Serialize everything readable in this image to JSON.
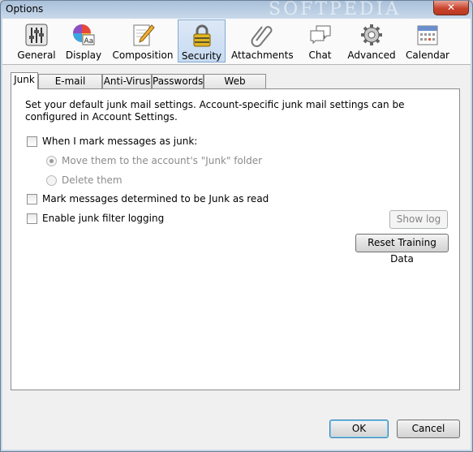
{
  "window": {
    "title": "Options",
    "close_symbol": "✕",
    "watermark": "SOFTPEDIA"
  },
  "toolbar": {
    "items": [
      {
        "label": "General",
        "icon": "sliders-icon",
        "selected": false
      },
      {
        "label": "Display",
        "icon": "palette-icon",
        "selected": false
      },
      {
        "label": "Composition",
        "icon": "pencil-paper-icon",
        "selected": false
      },
      {
        "label": "Security",
        "icon": "padlock-icon",
        "selected": true
      },
      {
        "label": "Attachments",
        "icon": "paperclip-icon",
        "selected": false
      },
      {
        "label": "Chat",
        "icon": "speech-bubbles-icon",
        "selected": false
      },
      {
        "label": "Advanced",
        "icon": "gear-icon",
        "selected": false
      },
      {
        "label": "Calendar",
        "icon": "calendar-icon",
        "selected": false
      }
    ]
  },
  "tabs": [
    {
      "label": "Junk",
      "active": true
    },
    {
      "label": "E-mail Scams",
      "active": false
    },
    {
      "label": "Anti-Virus",
      "active": false
    },
    {
      "label": "Passwords",
      "active": false
    },
    {
      "label": "Web Content",
      "active": false
    }
  ],
  "junk": {
    "description": "Set your default junk mail settings. Account-specific junk mail settings can be configured in Account Settings.",
    "mark_as_junk": {
      "label": "When I mark messages as junk:",
      "checked": false
    },
    "move_option": {
      "label": "Move them to the account's \"Junk\" folder",
      "selected": true,
      "disabled": true
    },
    "delete_option": {
      "label": "Delete them",
      "selected": false,
      "disabled": true
    },
    "mark_read": {
      "label": "Mark messages determined to be Junk as read",
      "checked": false
    },
    "logging": {
      "label": "Enable junk filter logging",
      "checked": false
    },
    "show_log_button": "Show log",
    "reset_button": "Reset Training Data"
  },
  "footer": {
    "ok_button": "OK",
    "cancel_button": "Cancel"
  }
}
